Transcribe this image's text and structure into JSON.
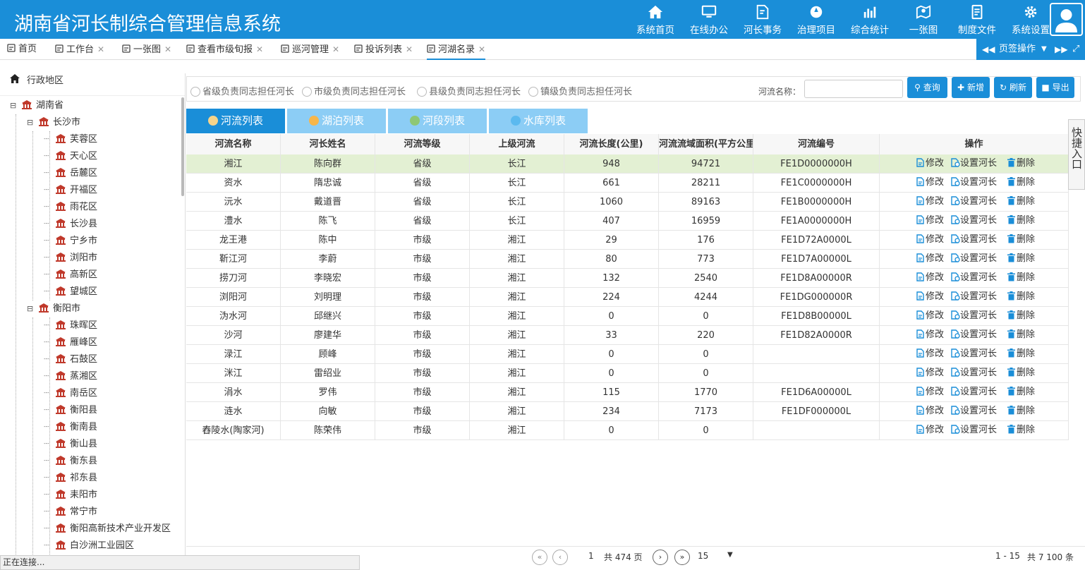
{
  "header": {
    "title": "湖南省河长制综合管理信息系统",
    "nav": [
      {
        "label": "系统首页",
        "icon": "home-icon"
      },
      {
        "label": "在线办公",
        "icon": "monitor-icon"
      },
      {
        "label": "河长事务",
        "icon": "edit-doc-icon"
      },
      {
        "label": "治理项目",
        "icon": "project-icon"
      },
      {
        "label": "综合统计",
        "icon": "bar-chart-icon"
      },
      {
        "label": "一张图",
        "icon": "map-icon"
      },
      {
        "label": "制度文件",
        "icon": "document-icon"
      },
      {
        "label": "系统设置",
        "icon": "gear-icon"
      }
    ]
  },
  "tabs": [
    {
      "label": "首页",
      "icon": "home-icon",
      "closable": false
    },
    {
      "label": "工作台",
      "icon": "desk-icon",
      "closable": true
    },
    {
      "label": "一张图",
      "icon": "map-icon",
      "closable": true
    },
    {
      "label": "查看市级旬报",
      "icon": "report-icon",
      "closable": true
    },
    {
      "label": "巡河管理",
      "icon": "doc-icon",
      "closable": true
    },
    {
      "label": "投诉列表",
      "icon": "table-icon",
      "closable": true
    },
    {
      "label": "河湖名录",
      "icon": "river-icon",
      "closable": true,
      "active": true
    }
  ],
  "tab_ops_label": "页签操作",
  "tree": {
    "header": "行政地区",
    "province": "湖南省",
    "cities": [
      {
        "name": "长沙市",
        "districts": [
          "芙蓉区",
          "天心区",
          "岳麓区",
          "开福区",
          "雨花区",
          "长沙县",
          "宁乡市",
          "浏阳市",
          "高新区",
          "望城区"
        ]
      },
      {
        "name": "衡阳市",
        "districts": [
          "珠晖区",
          "雁峰区",
          "石鼓区",
          "蒸湘区",
          "南岳区",
          "衡阳县",
          "衡南县",
          "衡山县",
          "衡东县",
          "祁东县",
          "耒阳市",
          "常宁市",
          "衡阳高新技术产业开发区",
          "白沙洲工业园区"
        ]
      }
    ]
  },
  "status_text": "正在连接...",
  "filters": {
    "radios": [
      "省级负责同志担任河长",
      "市级负责同志担任河长",
      "县级负责同志担任河长",
      "镇级负责同志担任河长"
    ],
    "river_name_label": "河流名称：",
    "river_name_value": "",
    "buttons": {
      "query": "查询",
      "add": "新增",
      "refresh": "刷新",
      "export": "导出"
    }
  },
  "subtabs": [
    {
      "label": "河流列表",
      "active": true
    },
    {
      "label": "湖泊列表",
      "active": false
    },
    {
      "label": "河段列表",
      "active": false
    },
    {
      "label": "水库列表",
      "active": false
    }
  ],
  "table": {
    "columns": [
      "河流名称",
      "河长姓名",
      "河流等级",
      "上级河流",
      "河流长度(公里)",
      "河流流域面积(平方公里)",
      "河流编号",
      "操作"
    ],
    "actions": [
      "修改",
      "设置河长",
      "删除"
    ],
    "rows": [
      [
        "湘江",
        "陈向群",
        "省级",
        "长江",
        "948",
        "94721",
        "FE1D0000000H"
      ],
      [
        "资水",
        "隋忠诚",
        "省级",
        "长江",
        "661",
        "28211",
        "FE1C0000000H"
      ],
      [
        "沅水",
        "戴道晋",
        "省级",
        "长江",
        "1060",
        "89163",
        "FE1B0000000H"
      ],
      [
        "澧水",
        "陈飞",
        "省级",
        "长江",
        "407",
        "16959",
        "FE1A0000000H"
      ],
      [
        "龙王港",
        "陈中",
        "市级",
        "湘江",
        "29",
        "176",
        "FE1D72A0000L"
      ],
      [
        "靳江河",
        "李蔚",
        "市级",
        "湘江",
        "80",
        "773",
        "FE1D7A00000L"
      ],
      [
        "捞刀河",
        "李晓宏",
        "市级",
        "湘江",
        "132",
        "2540",
        "FE1D8A00000R"
      ],
      [
        "浏阳河",
        "刘明理",
        "市级",
        "湘江",
        "224",
        "4244",
        "FE1DG000000R"
      ],
      [
        "沩水河",
        "邱继兴",
        "市级",
        "湘江",
        "0",
        "0",
        "FE1D8B00000L"
      ],
      [
        "沙河",
        "廖建华",
        "市级",
        "湘江",
        "33",
        "220",
        "FE1D82A0000R"
      ],
      [
        "渌江",
        "顾峰",
        "市级",
        "湘江",
        "0",
        "0",
        ""
      ],
      [
        "洣江",
        "雷绍业",
        "市级",
        "湘江",
        "0",
        "0",
        ""
      ],
      [
        "涓水",
        "罗伟",
        "市级",
        "湘江",
        "115",
        "1770",
        "FE1D6A00000L"
      ],
      [
        "涟水",
        "向敏",
        "市级",
        "湘江",
        "234",
        "7173",
        "FE1DF000000L"
      ],
      [
        "舂陵水(陶家河)",
        "陈荣伟",
        "市级",
        "湘江",
        "0",
        "0",
        ""
      ]
    ]
  },
  "quick_entry": "快捷入口",
  "pager": {
    "page": "1",
    "total_pages_text": "共 474 页",
    "page_size": "15",
    "range_text": "1 - 15",
    "total_text": "共 7 100 条"
  }
}
